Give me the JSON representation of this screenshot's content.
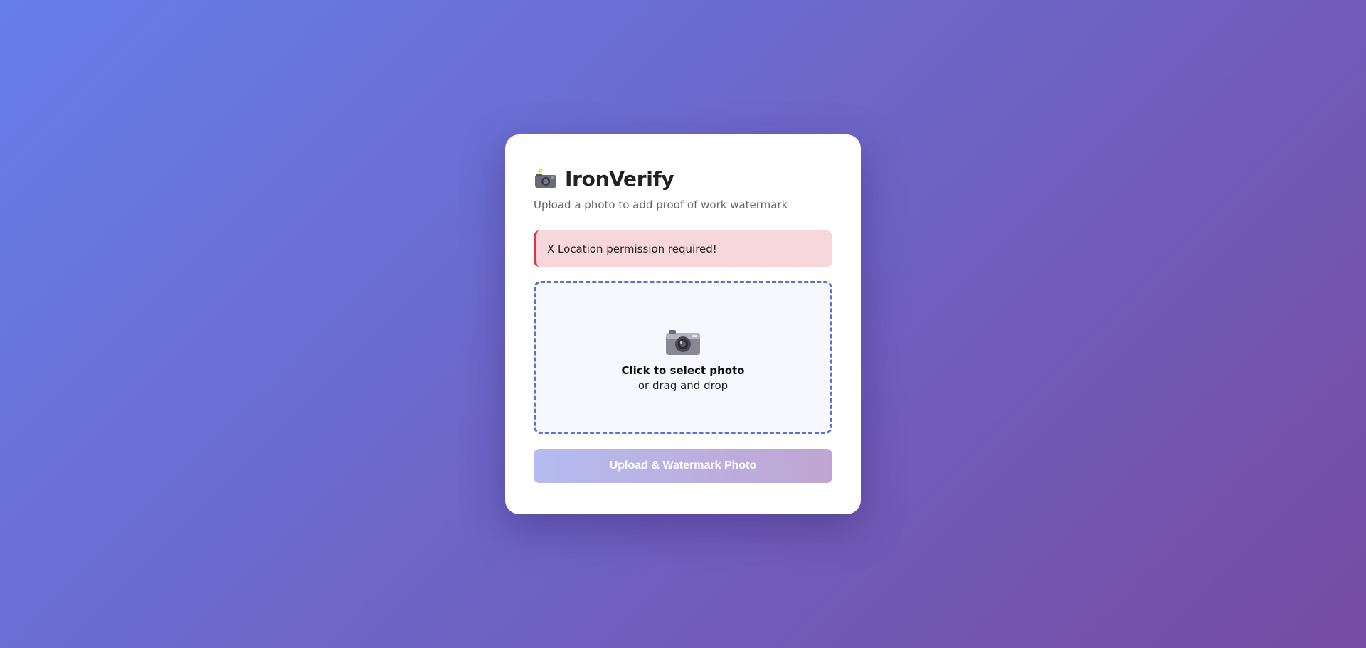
{
  "app": {
    "title": "IronVerify",
    "subtitle": "Upload a photo to add proof of work watermark",
    "logo_icon": "camera-with-flash-icon"
  },
  "alert": {
    "text": "X Location permission required!",
    "color": "#dc3545",
    "background": "#f8d7da"
  },
  "dropzone": {
    "icon": "camera-icon",
    "primary_text": "Click to select photo",
    "secondary_text": "or drag and drop"
  },
  "upload_button": {
    "label": "Upload & Watermark Photo",
    "disabled": true
  },
  "colors": {
    "background_start": "#667eea",
    "background_end": "#764ba2",
    "dropzone_border": "#5a72c8"
  }
}
